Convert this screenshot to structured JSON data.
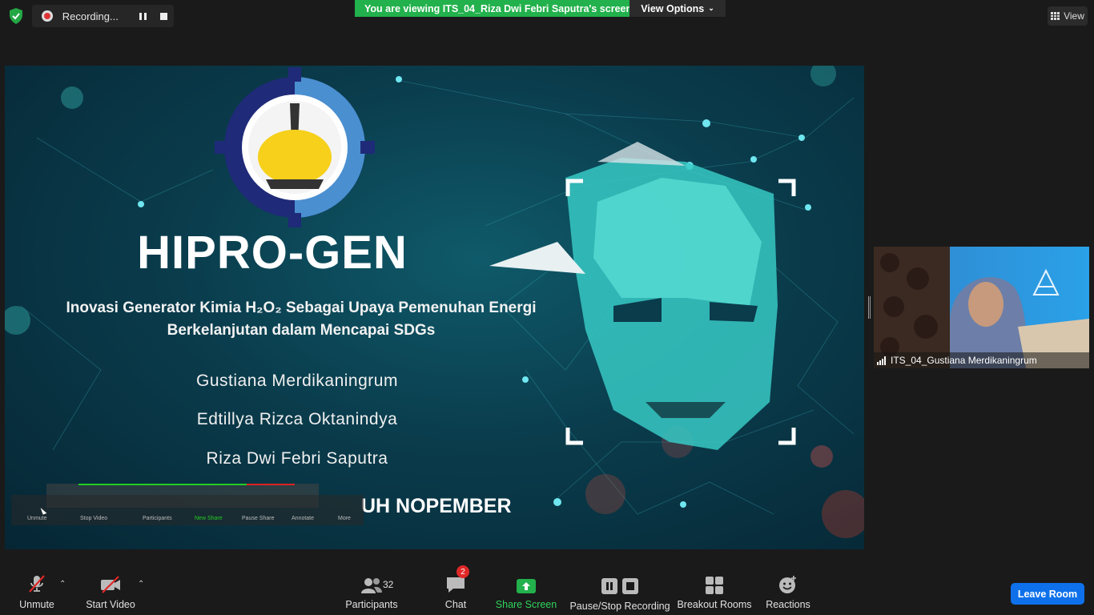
{
  "top": {
    "recording_label": "Recording...",
    "banner_text": "You are viewing ITS_04_Riza Dwi Febri Saputra's screen",
    "view_options_label": "View Options",
    "view_label": "View"
  },
  "slide": {
    "title": "HIPRO-GEN",
    "subtitle_line1": "Inovasi Generator Kimia H₂O₂ Sebagai Upaya Pemenuhan Energi",
    "subtitle_line2": "Berkelanjutan dalam Mencapai SDGs",
    "author1": "Gustiana Merdikaningrum",
    "author2": "Edtillya Rizca Oktanindya",
    "author3": "Riza Dwi Febri Saputra",
    "institution_fragment": "UH NOPEMBER",
    "mini_toolbar": {
      "unmute": "Unmute",
      "stop_video": "Stop Video",
      "participants": "Participants",
      "new_share": "New Share",
      "pause_share": "Pause Share",
      "annotate": "Annotate",
      "more": "More"
    }
  },
  "participant": {
    "name": "ITS_04_Gustiana Merdikaningrum"
  },
  "toolbar": {
    "unmute": "Unmute",
    "start_video": "Start Video",
    "participants": "Participants",
    "participants_count": "32",
    "chat": "Chat",
    "chat_badge": "2",
    "share_screen": "Share Screen",
    "pause_stop_recording": "Pause/Stop Recording",
    "breakout_rooms": "Breakout Rooms",
    "reactions": "Reactions",
    "leave_room": "Leave Room"
  },
  "colors": {
    "share_green": "#22b14c",
    "leave_blue": "#0e71eb",
    "badge_red": "#e02828",
    "muted_red": "#e02828"
  }
}
